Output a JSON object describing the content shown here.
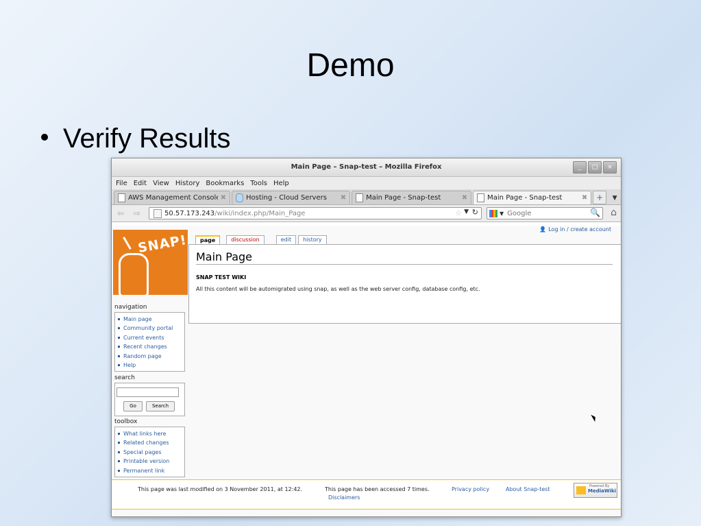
{
  "slide": {
    "title": "Demo",
    "bullet": "Verify Results"
  },
  "window": {
    "title": "Main Page – Snap-test – Mozilla Firefox",
    "controls": [
      "_",
      "□",
      "×"
    ]
  },
  "menu": [
    "File",
    "Edit",
    "View",
    "History",
    "Bookmarks",
    "Tools",
    "Help"
  ],
  "tabs": [
    {
      "label": "AWS Management Console",
      "icon": "page-icon"
    },
    {
      "label": "Hosting - Cloud Servers",
      "icon": "cloud-icon"
    },
    {
      "label": "Main Page - Snap-test",
      "icon": "page-icon"
    },
    {
      "label": "Main Page - Snap-test",
      "icon": "page-icon",
      "active": true
    }
  ],
  "navbar": {
    "url_host": "50.57.173.243",
    "url_path": "/wiki/index.php/Main_Page",
    "search_placeholder": "Google"
  },
  "wiki": {
    "login": "Log in / create account",
    "logo_text": "SNAP!",
    "page_tabs": [
      "page",
      "discussion",
      "edit",
      "history"
    ],
    "heading": "Main Page",
    "subheading": "SNAP TEST WIKI",
    "body": "All this content will be automigrated using snap, as well as the web server config, database config, etc.",
    "navigation": {
      "title": "navigation",
      "items": [
        "Main page",
        "Community portal",
        "Current events",
        "Recent changes",
        "Random page",
        "Help"
      ]
    },
    "search": {
      "title": "search",
      "go": "Go",
      "search": "Search"
    },
    "toolbox": {
      "title": "toolbox",
      "items": [
        "What links here",
        "Related changes",
        "Special pages",
        "Printable version",
        "Permanent link"
      ]
    },
    "footer": {
      "modified": "This page was last modified on 3 November 2011, at 12:42.",
      "accessed": "This page has been accessed 7 times.",
      "disclaimers": "Disclaimers",
      "privacy": "Privacy policy",
      "about": "About Snap-test",
      "badge_small": "Powered By",
      "badge_big": "MediaWiki"
    }
  },
  "colors": {
    "link": "#2a5d9f",
    "logo_bg": "#e87e1b",
    "accent": "#fabd23",
    "redlink": "#ba0000"
  }
}
